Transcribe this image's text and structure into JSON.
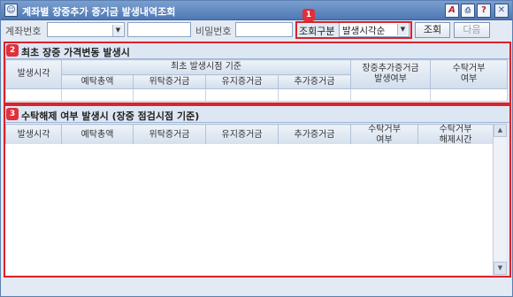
{
  "window": {
    "title": "계좌별 장중추가 증거금 발생내역조회",
    "app_icon": "person-icon"
  },
  "titlebar_buttons": [
    {
      "name": "font-icon",
      "glyph": "A"
    },
    {
      "name": "print-icon",
      "glyph": "⎙"
    },
    {
      "name": "help-icon",
      "glyph": "?"
    },
    {
      "name": "close-icon",
      "glyph": "✕"
    }
  ],
  "search": {
    "account_label": "계좌번호",
    "account_value": "",
    "password_label": "비밀번호",
    "password_value": "",
    "query_type_label": "조회구분",
    "query_type_value": "발생시각순",
    "query_button": "조회",
    "next_button": "다음"
  },
  "markers": [
    "1",
    "2",
    "3"
  ],
  "section1": {
    "title": "최초 장중 가격변동 발생시",
    "col_time": "발생시각",
    "group_header": "최초 발생시점 기준",
    "sub_cols": [
      "예탁총액",
      "위탁증거금",
      "유지증거금",
      "추가증거금"
    ],
    "col_margin": "장중추가증거금 발생여부",
    "col_margin_l1": "장중추가증거금",
    "col_margin_l2": "발생여부",
    "col_refuse_l1": "수탁거부",
    "col_refuse_l2": "여부"
  },
  "section2": {
    "title": "수탁해제 여부 발생시 (장중 점검시점 기준)",
    "cols": [
      "발생시각",
      "예탁총액",
      "위탁증거금",
      "유지증거금",
      "추가증거금"
    ],
    "col_refuse_l1": "수탁거부",
    "col_refuse_l2": "여부",
    "col_release_l1": "수탁거부",
    "col_release_l2": "해제시간"
  },
  "colors": {
    "highlight": "#d9232d",
    "titlebar": "#4f78b4"
  }
}
